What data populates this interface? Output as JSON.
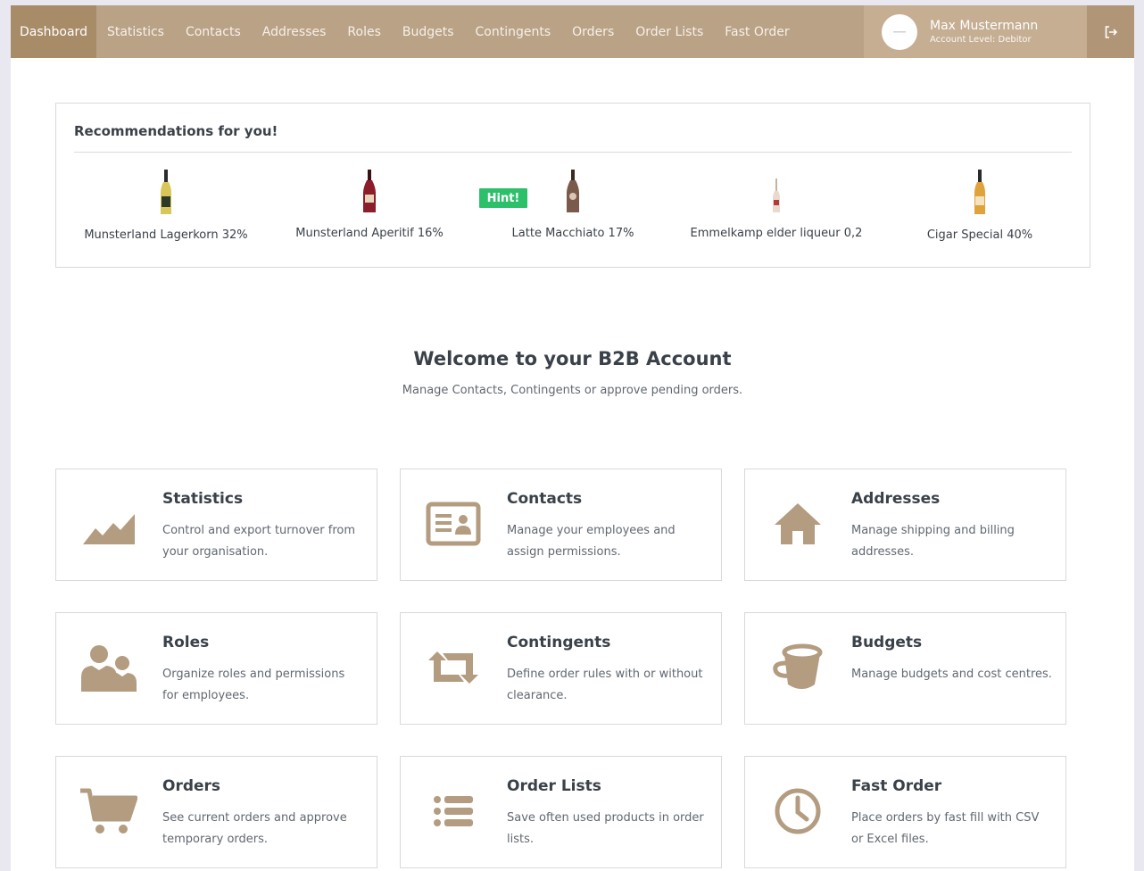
{
  "nav": {
    "items": [
      {
        "label": "Dashboard",
        "active": true
      },
      {
        "label": "Statistics"
      },
      {
        "label": "Contacts"
      },
      {
        "label": "Addresses"
      },
      {
        "label": "Roles"
      },
      {
        "label": "Budgets"
      },
      {
        "label": "Contingents"
      },
      {
        "label": "Orders"
      },
      {
        "label": "Order Lists"
      },
      {
        "label": "Fast Order"
      }
    ],
    "user": {
      "name": "Max Mustermann",
      "level": "Account Level: Debitor"
    },
    "logout_icon": "logout-icon"
  },
  "recommendations": {
    "title": "Recommendations for you!",
    "hint_label": "Hint!",
    "items": [
      {
        "name": "Munsterland Lagerkorn 32%"
      },
      {
        "name": "Munsterland Aperitif 16%"
      },
      {
        "name": "Latte Macchiato 17%"
      },
      {
        "name": "Emmelkamp elder liqueur 0,2"
      },
      {
        "name": "Cigar Special 40%"
      }
    ]
  },
  "welcome": {
    "title": "Welcome to your B2B Account",
    "subtitle": "Manage Contacts, Contingents or approve pending orders."
  },
  "cards": [
    {
      "title": "Statistics",
      "desc": "Control and export turnover from your organisation.",
      "icon": "area-chart-icon"
    },
    {
      "title": "Contacts",
      "desc": "Manage your employees and assign permissions.",
      "icon": "id-card-icon"
    },
    {
      "title": "Addresses",
      "desc": "Manage shipping and billing addresses.",
      "icon": "home-icon"
    },
    {
      "title": "Roles",
      "desc": "Organize roles and permissions for employees.",
      "icon": "users-icon"
    },
    {
      "title": "Contingents",
      "desc": "Define order rules with or without clearance.",
      "icon": "retweet-icon"
    },
    {
      "title": "Budgets",
      "desc": "Manage budgets and cost centres.",
      "icon": "bucket-icon"
    },
    {
      "title": "Orders",
      "desc": "See current orders and approve temporary orders.",
      "icon": "cart-icon"
    },
    {
      "title": "Order Lists",
      "desc": "Save often used products in order lists.",
      "icon": "list-icon"
    },
    {
      "title": "Fast Order",
      "desc": "Place orders by fast fill with CSV or Excel files.",
      "icon": "clock-icon"
    }
  ],
  "colors": {
    "brand": "#b9a286",
    "icon": "#b39c80",
    "hint": "#2dc06b"
  }
}
